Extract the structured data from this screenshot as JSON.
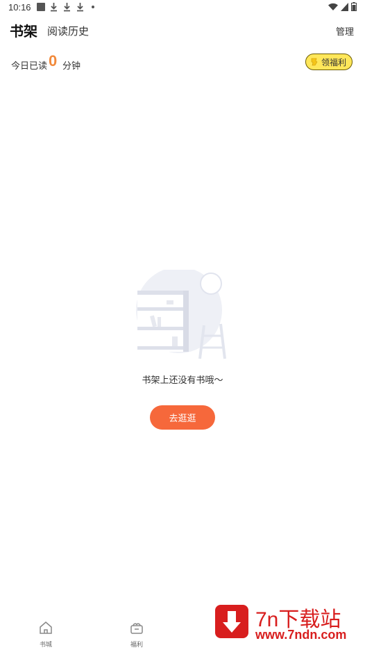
{
  "status_bar": {
    "time": "10:16"
  },
  "header": {
    "title": "书架",
    "history_tab": "阅读历史",
    "manage": "管理"
  },
  "reading": {
    "label": "今日已读",
    "minutes": "0",
    "unit": "分钟",
    "welfare_button": "领福利"
  },
  "empty_state": {
    "message": "书架上还没有书哦～",
    "browse_button": "去逛逛"
  },
  "bottom_nav": {
    "items": [
      {
        "label": "书城",
        "icon": "home-icon"
      },
      {
        "label": "福利",
        "icon": "gift-icon"
      }
    ]
  },
  "watermark": {
    "title": "7n下载站",
    "url": "www.7ndn.com"
  },
  "colors": {
    "accent": "#f6683b",
    "minutes": "#f28a3c",
    "welfare_bg": "#ffe75a",
    "watermark_red": "#d81e1e"
  }
}
